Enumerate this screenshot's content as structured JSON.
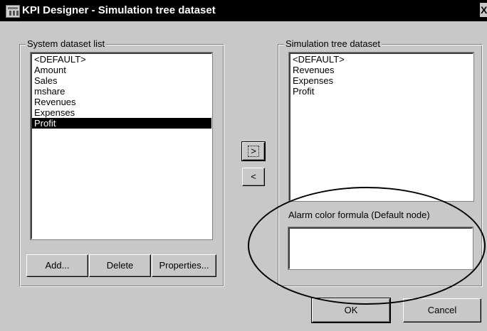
{
  "window": {
    "title": "KPI Designer - Simulation tree dataset",
    "close_label": "X",
    "icon": "kpi-designer-app-icon"
  },
  "system_dataset": {
    "label": "System dataset list",
    "items": [
      "<DEFAULT>",
      "Amount",
      "Sales",
      "mshare",
      "Revenues",
      "Expenses",
      "Profit"
    ],
    "selected_index": 6,
    "buttons": {
      "add": "Add...",
      "delete": "Delete",
      "properties": "Properties..."
    }
  },
  "transfer": {
    "add_label": ">",
    "remove_label": "<"
  },
  "simulation_tree": {
    "label": "Simulation tree dataset",
    "items": [
      "<DEFAULT>",
      "Revenues",
      "Expenses",
      "Profit"
    ]
  },
  "alarm": {
    "label": "Alarm color formula (Default node)",
    "value": ""
  },
  "actions": {
    "ok": "OK",
    "cancel": "Cancel"
  },
  "annotation": {
    "shape": "hand-drawn oval around alarm color formula",
    "color": "#000000"
  }
}
